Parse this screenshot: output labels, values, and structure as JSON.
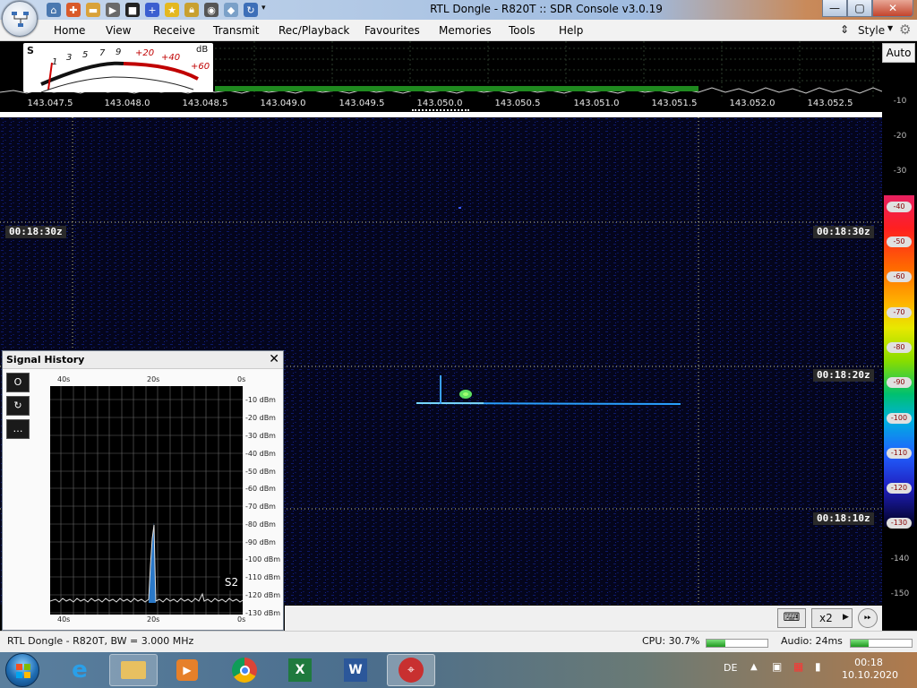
{
  "window": {
    "title": "RTL Dongle - R820T :: SDR Console v3.0.19",
    "controls": {
      "minimize": "—",
      "maximize": "▢",
      "close": "✕"
    }
  },
  "menu": {
    "items": [
      "Home",
      "View",
      "Receive",
      "Transmit",
      "Rec/Playback",
      "Favourites",
      "Memories",
      "Tools",
      "Help"
    ],
    "style_label": "Style"
  },
  "smeter": {
    "s_label": "S",
    "db_label": "dB",
    "s_ticks": [
      "1",
      "3",
      "5",
      "7",
      "9"
    ],
    "plus_ticks": [
      "+20",
      "+40",
      "+60"
    ]
  },
  "frequency_axis": [
    "143.047.5",
    "143.048.0",
    "143.048.5",
    "143.049.0",
    "143.049.5",
    "143.050.0",
    "143.050.5",
    "143.051.0",
    "143.051.5",
    "143.052.0",
    "143.052.5"
  ],
  "waterfall": {
    "time_markers": [
      "00:18:30z",
      "00:18:20z",
      "00:18:10z"
    ]
  },
  "right_scale": {
    "auto_label": "Auto",
    "upper_ticks": [
      "-10",
      "-20",
      "-30"
    ],
    "color_ticks": [
      "-40",
      "-50",
      "-60",
      "-70",
      "-80",
      "-90",
      "-100",
      "-110",
      "-120",
      "-130"
    ],
    "lower_ticks": [
      "-140",
      "-150"
    ]
  },
  "signal_history": {
    "title": "Signal History",
    "close": "✕",
    "toolbar": [
      "O",
      "↻",
      "…"
    ],
    "time_top": [
      "40s",
      "20s",
      "0s"
    ],
    "time_bottom": [
      "40s",
      "20s",
      "0s"
    ],
    "dbm_ticks": [
      "-10 dBm",
      "-20 dBm",
      "-30 dBm",
      "-40 dBm",
      "-50 dBm",
      "-60 dBm",
      "-70 dBm",
      "-80 dBm",
      "-90 dBm",
      "-100 dBm",
      "-110 dBm",
      "-120 dBm",
      "-130 dBm"
    ],
    "s_reading": "S2"
  },
  "bottom_tools": {
    "zoom": "x2"
  },
  "status": {
    "device": "RTL Dongle - R820T, BW = 3.000 MHz",
    "cpu": "CPU: 30.7%",
    "cpu_level": 0.307,
    "audio": "Audio: 24ms",
    "audio_level": 0.3
  },
  "taskbar": {
    "lang": "DE",
    "time": "00:18",
    "date": "10.10.2020"
  }
}
